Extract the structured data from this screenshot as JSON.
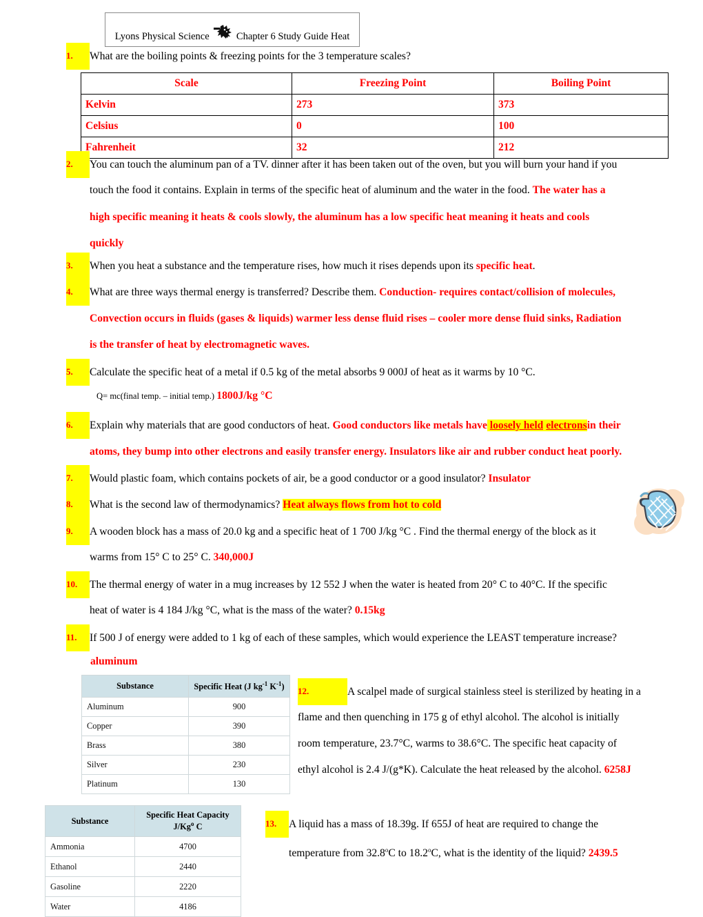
{
  "header": {
    "left_text": "Lyons Physical Science",
    "icon": "sun-burst-icon",
    "right_text": "Chapter 6 Study Guide Heat"
  },
  "colors": {
    "answer_red": "#ff0000",
    "highlight_yellow": "#ffff00",
    "table_header_blue": "#cfe2e8",
    "mitt_blue": "#8ecbe8",
    "mitt_bg_peach": "#fbdfc4"
  },
  "questions": [
    {
      "number": "1.",
      "prompt": "What are the boiling points & freezing points for the 3 temperature scales?"
    },
    {
      "number": "2.",
      "prompt_line1": "You can touch the aluminum pan of a TV. dinner after it has been taken out of the oven, but you will burn your hand if you",
      "prompt_line2": "touch the food it contains.  Explain in terms of the specific heat of aluminum and the water in the food.",
      "answer_line2": "The water has a",
      "answer_line3": "high specific meaning it heats & cools slowly, the aluminum has a low specific heat meaning it heats and cools",
      "answer_line4": "quickly"
    },
    {
      "number": "3.",
      "prompt": "When you heat a substance and the temperature rises, how much it rises depends upon its",
      "answer": "specific heat",
      "tail": "."
    },
    {
      "number": "4.",
      "prompt": "What are three ways thermal energy is transferred? Describe them.",
      "answer_line1": "Conduction- requires contact/collision of molecules,",
      "answer_line2": "Convection occurs in fluids (gases & liquids) warmer less dense fluid rises – cooler more dense fluid sinks, Radiation",
      "answer_line3": "is the transfer of heat by electromagnetic waves."
    },
    {
      "number": "5.",
      "prompt": "Calculate the specific heat of a metal if 0.5 kg of the metal absorbs 9 000J of heat as it warms by 10 °C.",
      "formula": "Q= mc(final temp. – initial temp.)",
      "answer": "1800J/kg °C"
    },
    {
      "number": "6.",
      "prompt": "Explain why materials that are good conductors of heat.",
      "answer_part1": "Good conductors like metals have",
      "answer_highlight1": "loosely held",
      "answer_highlight2": "electrons",
      "answer_part2": "in their",
      "answer_line2": "atoms, they bump into other electrons and easily transfer energy. Insulators like air and rubber conduct heat poorly."
    },
    {
      "number": "7.",
      "prompt": "Would plastic foam, which contains pockets of air, be a good conductor or a good insulator?",
      "answer": "Insulator"
    },
    {
      "number": "8.",
      "prompt": "What is the second law of thermodynamics?",
      "answer_highlighted": "Heat always flows from hot to cold"
    },
    {
      "number": "9.",
      "prompt_line1": "A wooden block has a mass of 20.0 kg and a specific heat of 1 700 J/kg °C .  Find the thermal energy of the block as it",
      "prompt_line2": "warms from 15° C to 25° C.",
      "answer": "340,000J"
    },
    {
      "number": "10.",
      "prompt_line1": "The thermal energy of water in a mug increases by 12 552 J when the water is heated from 20° C to 40°C.  If the specific",
      "prompt_line2": "heat of water is 4 184 J/kg °C, what is the mass of the water?",
      "answer": "0.15kg"
    },
    {
      "number": "11.",
      "prompt": "If 500 J of energy were added to 1 kg of each of these samples, which would experience the LEAST temperature increase?",
      "answer": "aluminum"
    },
    {
      "number": "12.",
      "prompt_line1": "A scalpel made of surgical stainless steel is sterilized by heating in a",
      "prompt_line2": "flame and then quenching in 175 g of ethyl alcohol. The alcohol is initially",
      "prompt_line3": "room temperature, 23.7°C, warms to 38.6°C. The specific heat capacity of",
      "prompt_line4": "ethyl alcohol is 2.4 J/(g*K). Calculate the heat released by the alcohol.",
      "answer": "6258J"
    },
    {
      "number": "13.",
      "prompt_line1": "A liquid has a mass of 18.39g. If 655J of heat are required to change the",
      "prompt_line2_a": "temperature from 32.8",
      "prompt_line2_sup1": "o",
      "prompt_line2_b": "C to 18.2",
      "prompt_line2_sup2": "o",
      "prompt_line2_c": "C, what is the identity of the liquid?",
      "answer": "2439.5"
    }
  ],
  "temp_table": {
    "headers": [
      "Scale",
      "Freezing Point",
      "Boiling Point"
    ],
    "rows": [
      [
        "Kelvin",
        "273",
        "373"
      ],
      [
        "Celsius",
        "0",
        "100"
      ],
      [
        "Fahrenheit",
        "32",
        "212"
      ]
    ]
  },
  "specific_heat_table": {
    "headers": [
      "Substance",
      "Specific Heat (J kg",
      "K",
      ")"
    ],
    "header_col2_base": "Specific Heat (J kg",
    "header_col2_sup1": "-1",
    "header_col2_mid": " K",
    "header_col2_sup2": "-1",
    "header_col2_end": ")",
    "rows": [
      [
        "Aluminum",
        "900"
      ],
      [
        "Copper",
        "390"
      ],
      [
        "Brass",
        "380"
      ],
      [
        "Silver",
        "230"
      ],
      [
        "Platinum",
        "130"
      ]
    ]
  },
  "heat_capacity_table": {
    "header_col1": "Substance",
    "header_col2_line1": "Specific Heat Capacity",
    "header_col2_line2_a": "J/Kg",
    "header_col2_line2_sup": "o",
    "header_col2_line2_b": " C",
    "rows": [
      [
        "Ammonia",
        "4700"
      ],
      [
        "Ethanol",
        "2440"
      ],
      [
        "Gasoline",
        "2220"
      ],
      [
        "Water",
        "4186"
      ]
    ]
  }
}
